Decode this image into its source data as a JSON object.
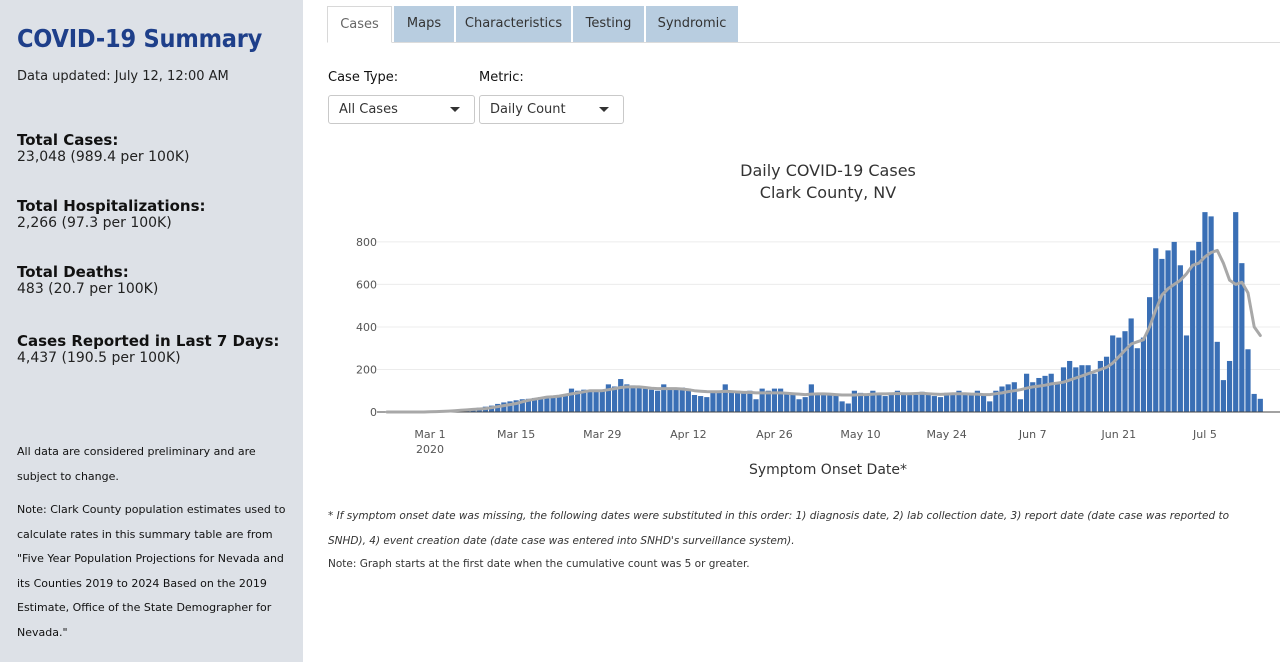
{
  "sidebar": {
    "title": "COVID-19 Summary",
    "updated": "Data updated: July 12, 12:00 AM",
    "stats": [
      {
        "label": "Total Cases:",
        "value": "23,048 (989.4 per 100K)"
      },
      {
        "label": "Total Hospitalizations:",
        "value": "2,266 (97.3 per 100K)"
      },
      {
        "label": "Total Deaths:",
        "value": "483 (20.7 per 100K)"
      },
      {
        "label": "Cases Reported in Last 7 Days:",
        "value": "4,437 (190.5 per 100K)"
      }
    ],
    "note1": "All data are considered preliminary and are subject to change.",
    "note2": "Note: Clark County population estimates used to calculate rates in this summary table are from \"Five Year Population Projections for Nevada and its Counties 2019 to 2024 Based on the 2019 Estimate, Office of the State Demographer for Nevada.\""
  },
  "tabs": [
    {
      "label": "Cases",
      "active": true
    },
    {
      "label": "Maps",
      "active": false
    },
    {
      "label": "Characteristics",
      "active": false
    },
    {
      "label": "Testing",
      "active": false
    },
    {
      "label": "Syndromic",
      "active": false
    }
  ],
  "controls": {
    "case_type_label": "Case Type:",
    "case_type_value": "All Cases",
    "metric_label": "Metric:",
    "metric_value": "Daily Count"
  },
  "footnotes": {
    "note1": "* If symptom onset date was missing, the following dates were substituted in this order: 1) diagnosis date, 2) lab collection date, 3) report date (date case was reported to SNHD), 4) event creation date (date case was entered into SNHD's surveillance system).",
    "note2": "Note: Graph starts at the first date when the cumulative count was 5 or greater."
  },
  "colors": {
    "bar": "#3a6fb5",
    "average_line": "#a8a8a8",
    "sidebar_bg": "#dde1e7",
    "title": "#1e3f8a",
    "tab_bg": "#b8cde0"
  },
  "chart_data": {
    "type": "bar",
    "title_line1": "Daily COVID-19 Cases",
    "title_line2": "Clark County, NV",
    "xlabel": "Symptom Onset Date*",
    "ylabel": "",
    "ylim": [
      0,
      950
    ],
    "yticks": [
      0,
      200,
      400,
      600,
      800
    ],
    "x_start": "2020-02-23",
    "xticks": [
      {
        "day": 7,
        "label": "Mar 1",
        "sub": "2020"
      },
      {
        "day": 21,
        "label": "Mar 15",
        "sub": ""
      },
      {
        "day": 35,
        "label": "Mar 29",
        "sub": ""
      },
      {
        "day": 49,
        "label": "Apr 12",
        "sub": ""
      },
      {
        "day": 63,
        "label": "Apr 26",
        "sub": ""
      },
      {
        "day": 77,
        "label": "May 10",
        "sub": ""
      },
      {
        "day": 91,
        "label": "May 24",
        "sub": ""
      },
      {
        "day": 105,
        "label": "Jun 7",
        "sub": ""
      },
      {
        "day": 119,
        "label": "Jun 21",
        "sub": ""
      },
      {
        "day": 133,
        "label": "Jul 5",
        "sub": ""
      }
    ],
    "series": [
      {
        "type": "bar",
        "values": [
          0,
          0,
          0,
          0,
          0,
          0,
          0,
          1,
          2,
          4,
          6,
          8,
          10,
          12,
          15,
          20,
          25,
          30,
          38,
          45,
          50,
          55,
          60,
          62,
          66,
          70,
          75,
          70,
          80,
          78,
          110,
          100,
          105,
          100,
          95,
          100,
          130,
          120,
          155,
          130,
          125,
          120,
          110,
          105,
          100,
          130,
          115,
          110,
          115,
          110,
          80,
          75,
          70,
          90,
          95,
          130,
          90,
          100,
          90,
          100,
          60,
          110,
          100,
          110,
          110,
          85,
          80,
          60,
          70,
          130,
          90,
          90,
          85,
          85,
          50,
          40,
          100,
          90,
          80,
          100,
          90,
          75,
          85,
          100,
          80,
          85,
          80,
          95,
          80,
          75,
          70,
          90,
          90,
          100,
          90,
          85,
          100,
          80,
          50,
          100,
          120,
          130,
          140,
          60,
          180,
          140,
          160,
          170,
          180,
          140,
          210,
          240,
          210,
          220,
          220,
          180,
          240,
          260,
          360,
          350,
          380,
          440,
          300,
          350,
          540,
          770,
          720,
          760,
          800,
          690,
          360,
          760,
          800,
          940,
          920,
          330,
          150,
          240,
          940,
          700,
          295,
          85,
          62
        ]
      },
      {
        "type": "line",
        "values": [
          0,
          0,
          0,
          0,
          0,
          0,
          0,
          1,
          2,
          3,
          4,
          6,
          8,
          10,
          12,
          14,
          16,
          20,
          25,
          30,
          35,
          40,
          48,
          55,
          60,
          65,
          70,
          72,
          75,
          80,
          85,
          90,
          95,
          100,
          100,
          100,
          105,
          110,
          115,
          118,
          118,
          118,
          115,
          112,
          110,
          110,
          110,
          110,
          108,
          105,
          100,
          98,
          96,
          95,
          95,
          98,
          96,
          94,
          92,
          92,
          90,
          90,
          90,
          90,
          90,
          88,
          86,
          84,
          82,
          84,
          85,
          85,
          84,
          82,
          80,
          80,
          80,
          82,
          82,
          84,
          85,
          85,
          86,
          87,
          86,
          86,
          87,
          88,
          86,
          84,
          83,
          84,
          86,
          86,
          86,
          84,
          84,
          82,
          82,
          86,
          90,
          96,
          100,
          105,
          112,
          118,
          122,
          126,
          132,
          136,
          140,
          150,
          160,
          170,
          180,
          190,
          200,
          210,
          230,
          260,
          290,
          320,
          330,
          340,
          400,
          480,
          550,
          580,
          600,
          620,
          650,
          690,
          700,
          730,
          750,
          760,
          700,
          620,
          600,
          610,
          560,
          400,
          360
        ]
      }
    ]
  }
}
